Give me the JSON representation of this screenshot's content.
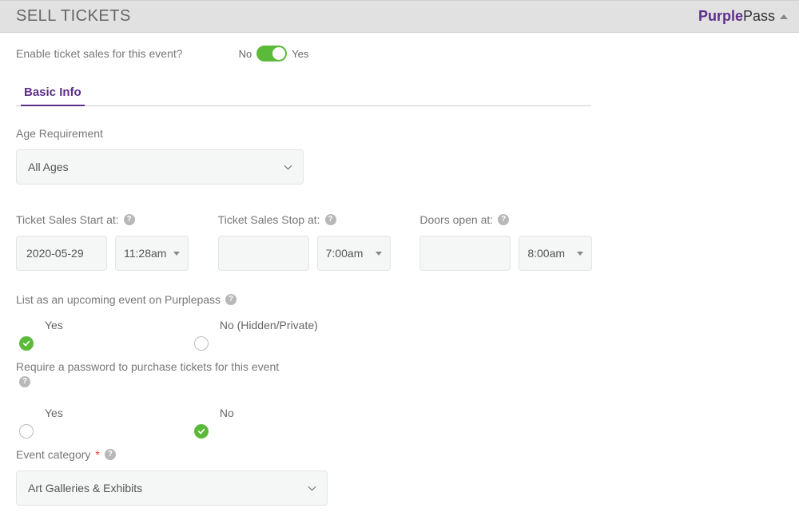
{
  "header": {
    "title": "SELL TICKETS",
    "brand_part1": "Purple",
    "brand_part2": "Pass"
  },
  "enable": {
    "question": "Enable ticket sales for this event?",
    "no_label": "No",
    "yes_label": "Yes",
    "value": true
  },
  "tabs": [
    {
      "label": "Basic Info",
      "active": true
    }
  ],
  "age": {
    "label": "Age Requirement",
    "value": "All Ages"
  },
  "times": {
    "start": {
      "label": "Ticket Sales Start at:",
      "date": "2020-05-29",
      "time": "11:28am"
    },
    "stop": {
      "label": "Ticket Sales Stop at:",
      "date": "",
      "time": "7:00am"
    },
    "doors": {
      "label": "Doors open at:",
      "date": "",
      "time": "8:00am"
    }
  },
  "listing": {
    "label": "List as an upcoming event on Purplepass",
    "yes_label": "Yes",
    "no_label": "No (Hidden/Private)",
    "value": "yes"
  },
  "password": {
    "label": "Require a password to purchase tickets for this event",
    "yes_label": "Yes",
    "no_label": "No",
    "value": "no"
  },
  "category": {
    "label": "Event category",
    "value": "Art Galleries & Exhibits"
  }
}
